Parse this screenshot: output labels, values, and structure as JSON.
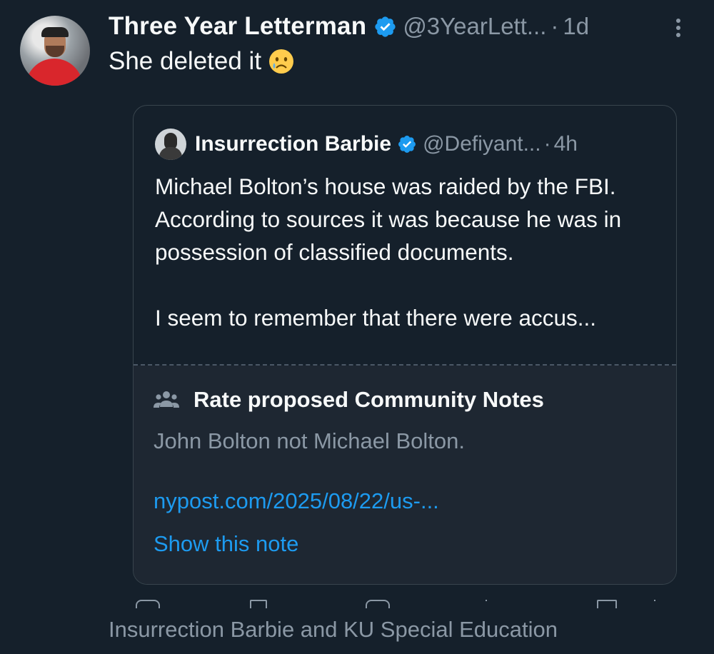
{
  "tweet": {
    "author_name": "Three Year Letterman",
    "author_handle": "@3YearLett...",
    "separator": "·",
    "time": "1d",
    "text": "She deleted it",
    "emoji": "crying-face-emoji"
  },
  "quoted_tweet": {
    "author_name": "Insurrection Barbie",
    "author_handle": "@Defiyant...",
    "separator": "·",
    "time": "4h",
    "text_line1": "Michael Bolton’s house was raided by the FBI. According to sources it was because he was in possession of classified documents.",
    "text_line2": "I seem to remember that there were accus..."
  },
  "community_note": {
    "title": "Rate proposed Community Notes",
    "text": "John Bolton not Michael Bolton.",
    "link": "nypost.com/2025/08/22/us-...",
    "show_label": "Show this note"
  },
  "footer": {
    "text": "Insurrection Barbie and KU Special Education"
  },
  "colors": {
    "background": "#15202b",
    "link": "#1d9bf0",
    "verified": "#1d9bf0",
    "muted": "#8b98a5"
  }
}
